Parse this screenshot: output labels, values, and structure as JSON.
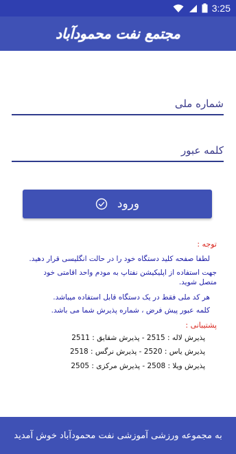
{
  "status_bar": {
    "time": "3:25",
    "icons": [
      "wifi-icon",
      "signal-icon",
      "battery-icon"
    ]
  },
  "app_bar": {
    "title": "مجتمع نفت محمودآباد"
  },
  "form": {
    "national_id_placeholder": "شماره ملی",
    "password_placeholder": "کلمه عبور",
    "login_label": "ورود",
    "login_icon": "check-circle-icon"
  },
  "notice": {
    "title": "توجه :",
    "lines": [
      "لطفا صفحه کلید دستگاه خود را در حالت انگلیسی قرار دهید.",
      "جهت استفاده از اپلیکیشن نفتاپ به مودم واحد اقامتی خود",
      "متصل شوید.",
      "هر کد ملی فقط در یک دستگاه قابل استفاده میباشد.",
      "کلمه عبور پیش فرض ، شماره پذیرش شما می باشد."
    ]
  },
  "support": {
    "title": "پشتیبانی :",
    "lines": [
      "پذیرش لاله : 2515 - پذیرش شقایق : 2511",
      "پذیرش یاس : 2520 - پذیرش نرگس : 2518",
      "پذیرش ویلا : 2508 - پذیرش مرکزی : 2505"
    ]
  },
  "footer": {
    "text": "به مجموعه ورزشی آموزشی نفت محمودآباد خوش آمدید"
  },
  "colors": {
    "primary": "#3f51b5",
    "status_bar": "#2f3fb0",
    "notice_title": "#d9251d",
    "notice_text": "#1a1aa6"
  }
}
